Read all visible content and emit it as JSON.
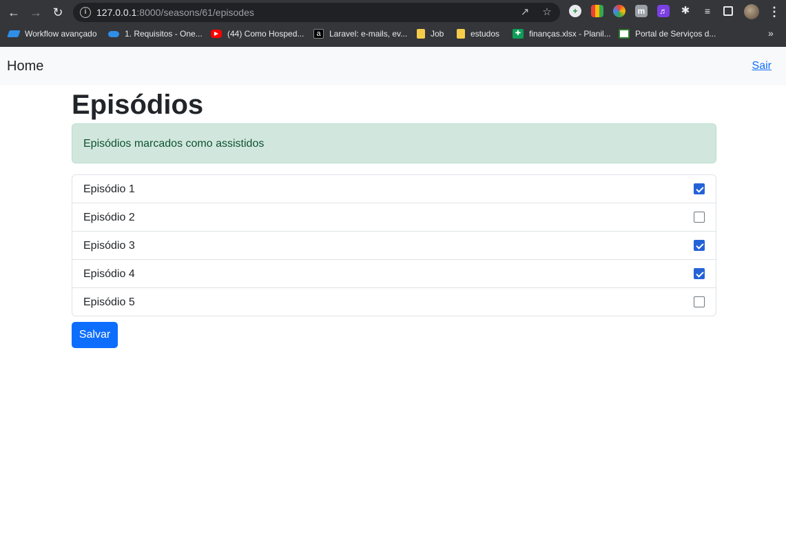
{
  "browser": {
    "url_host": "127.0.0.1",
    "url_rest": ":8000/seasons/61/episodes",
    "bookmarks": [
      {
        "label": "Workflow avançado",
        "color": "#2f8ee5"
      },
      {
        "label": "1. Requisitos - One...",
        "color": "#2f8ee5"
      },
      {
        "label": "(44) Como Hosped...",
        "color": "#ff0000"
      },
      {
        "label": "Laravel: e-mails, ev...",
        "color": "#000000"
      },
      {
        "label": "Job",
        "color": "#f6cc4b"
      },
      {
        "label": "estudos",
        "color": "#f6cc4b"
      },
      {
        "label": "finanças.xlsx - Planil...",
        "color": "#0f9d58"
      },
      {
        "label": "Portal de Serviços d...",
        "color": "#ffffff"
      }
    ],
    "more_bookmarks": "»"
  },
  "navbar": {
    "brand": "Home",
    "logout": "Sair"
  },
  "main": {
    "title": "Episódios",
    "alert": "Episódios marcados como assistidos",
    "episodes": [
      {
        "label": "Episódio 1",
        "watched": true
      },
      {
        "label": "Episódio 2",
        "watched": false
      },
      {
        "label": "Episódio 3",
        "watched": true
      },
      {
        "label": "Episódio 4",
        "watched": true
      },
      {
        "label": "Episódio 5",
        "watched": false
      }
    ],
    "save_label": "Salvar"
  },
  "colors": {
    "primary": "#0d6efd",
    "alert_bg": "#d1e7dd",
    "alert_text": "#0f5132",
    "checkbox_checked": "#2463d6"
  }
}
